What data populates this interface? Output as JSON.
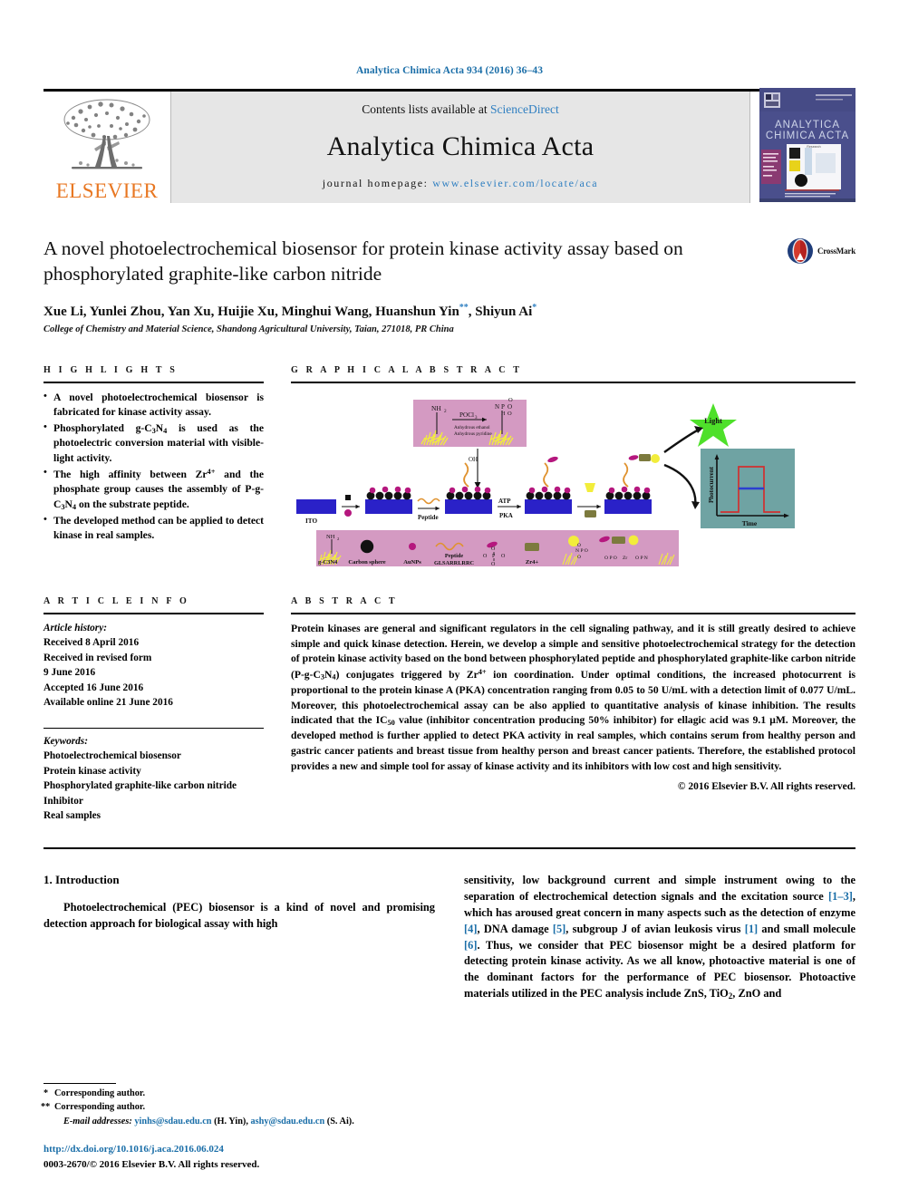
{
  "running_head": "Analytica Chimica Acta 934 (2016) 36–43",
  "masthead": {
    "publisher": "ELSEVIER",
    "contents_prefix": "Contents lists available at ",
    "contents_link": "ScienceDirect",
    "journal_title": "Analytica Chimica Acta",
    "homepage_prefix": "journal homepage: ",
    "homepage_url": "www.elsevier.com/locate/aca",
    "cover_title_line1": "ANALYTICA",
    "cover_title_line2": "CHIMICA ACTA"
  },
  "article": {
    "title": "A novel photoelectrochemical biosensor for protein kinase activity assay based on phosphorylated graphite-like carbon nitride",
    "authors": "Xue Li, Yunlei Zhou, Yan Xu, Huijie Xu, Minghui Wang, Huanshun Yin",
    "authors_tail": ", Shiyun Ai",
    "affiliation": "College of Chemistry and Material Science, Shandong Agricultural University, Taian, 271018, PR China",
    "crossmark_label": "CrossMark"
  },
  "highlights": {
    "heading": "H I G H L I G H T S",
    "items": [
      "A novel photoelectrochemical biosensor is fabricated for kinase activity assay.",
      "Phosphorylated g-C3N4 is used as the photoelectric conversion material with visible-light activity.",
      "The high affinity between Zr4+ and the phosphate group causes the assembly of P-g-C3N4 on the substrate peptide.",
      "The developed method can be applied to detect kinase in real samples."
    ]
  },
  "graphical_abstract": {
    "heading": "G R A P H I C A L   A B S T R A C T",
    "labels": {
      "ito": "ITO",
      "peptide": "Peptide",
      "atp": "ATP",
      "pka": "PKA",
      "light": "Light",
      "nh2": "NH2",
      "pocl3": "POCl3",
      "cond1": "Anhydrous ethanol",
      "cond2": "Anhydrous pyridine",
      "chart_y": "Photocurrent",
      "chart_x": "Time",
      "legend_gcn": "g-C3N4",
      "legend_carbon": "Carbon sphere",
      "legend_aunps": "AuNPs",
      "legend_peptide_1": "Peptide",
      "legend_peptide_2": "GLSARRLRRC",
      "legend_zr": "Zr4+"
    }
  },
  "article_info": {
    "heading": "A R T I C L E   I N F O",
    "history_label": "Article history:",
    "history": [
      "Received 8 April 2016",
      "Received in revised form",
      "9 June 2016",
      "Accepted 16 June 2016",
      "Available online 21 June 2016"
    ],
    "keywords_label": "Keywords:",
    "keywords": [
      "Photoelectrochemical biosensor",
      "Protein kinase activity",
      "Phosphorylated graphite-like carbon nitride",
      "Inhibitor",
      "Real samples"
    ]
  },
  "abstract": {
    "heading": "A B S T R A C T",
    "text": "Protein kinases are general and significant regulators in the cell signaling pathway, and it is still greatly desired to achieve simple and quick kinase detection. Herein, we develop a simple and sensitive photoelectrochemical strategy for the detection of protein kinase activity based on the bond between phosphorylated peptide and phosphorylated graphite-like carbon nitride (P-g-C3N4) conjugates triggered by Zr4+ ion coordination. Under optimal conditions, the increased photocurrent is proportional to the protein kinase A (PKA) concentration ranging from 0.05 to 50 U/mL with a detection limit of 0.077 U/mL. Moreover, this photoelectrochemical assay can be also applied to quantitative analysis of kinase inhibition. The results indicated that the IC50 value (inhibitor concentration producing 50% inhibitor) for ellagic acid was 9.1 μM. Moreover, the developed method is further applied to detect PKA activity in real samples, which contains serum from healthy person and gastric cancer patients and breast tissue from healthy person and breast cancer patients. Therefore, the established protocol provides a new and simple tool for assay of kinase activity and its inhibitors with low cost and high sensitivity.",
    "copyright": "© 2016 Elsevier B.V. All rights reserved."
  },
  "introduction": {
    "heading": "1. Introduction",
    "left_paragraph": "Photoelectrochemical (PEC) biosensor is a kind of novel and promising detection approach for biological assay with high",
    "right_paragraph_1": "sensitivity, low background current and simple instrument owing to the separation of electrochemical detection signals and the excitation source ",
    "right_ref_13": "[1–3]",
    "right_paragraph_2": ", which has aroused great concern in many aspects such as the detection of enzyme ",
    "right_ref_4": "[4]",
    "right_paragraph_3": ", DNA damage ",
    "right_ref_5": "[5]",
    "right_paragraph_4": ", subgroup J of avian leukosis virus ",
    "right_ref_1": "[1]",
    "right_paragraph_5": " and small molecule ",
    "right_ref_6": "[6]",
    "right_paragraph_6": ". Thus, we consider that PEC biosensor might be a desired platform for detecting protein kinase activity. As we all know, photoactive material is one of the dominant factors for the performance of PEC biosensor. Photoactive materials utilized in the PEC analysis include ZnS, TiO2, ZnO and"
  },
  "footnote": {
    "corresponding_1": "Corresponding author.",
    "corresponding_2": "Corresponding author.",
    "email_label": "E-mail addresses:",
    "email_1": "yinhs@sdau.edu.cn",
    "email_1_who": " (H. Yin), ",
    "email_2": "ashy@sdau.edu.cn",
    "email_2_who": " (S. Ai)."
  },
  "doi_block": {
    "doi": "http://dx.doi.org/10.1016/j.aca.2016.06.024",
    "issn": "0003-2670/© 2016 Elsevier B.V. All rights reserved."
  },
  "colors": {
    "link_blue": "#1a6ea8",
    "elsevier_orange": "#E87722",
    "ga_pink": "#d49ac2",
    "ga_blue": "#2a21c8",
    "ga_magenta": "#b5177e",
    "ga_teal": "#6fa3a3",
    "ga_green": "#4ee02a",
    "ga_yellow": "#f2ed3b"
  }
}
